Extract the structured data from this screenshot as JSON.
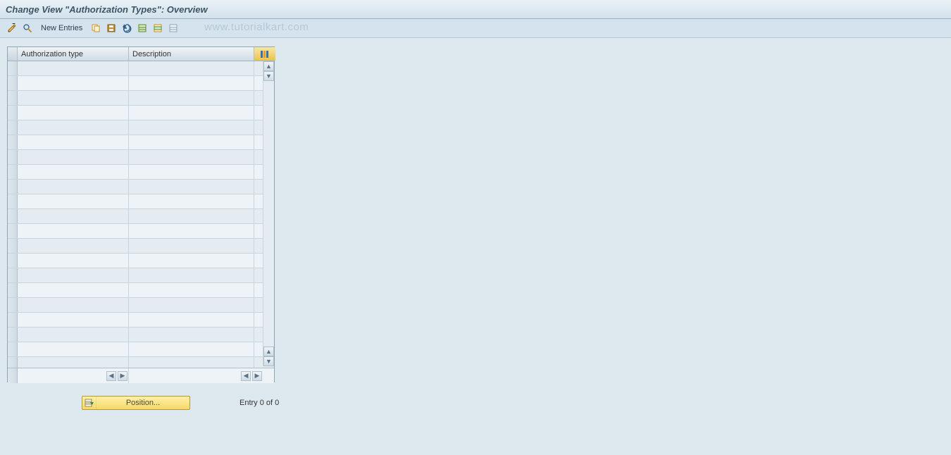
{
  "header": {
    "title": "Change View \"Authorization Types\": Overview"
  },
  "toolbar": {
    "new_entries_label": "New Entries"
  },
  "watermark": "www.tutorialkart.com",
  "table": {
    "columns": {
      "col1": "Authorization type",
      "col2": "Description"
    },
    "rows": []
  },
  "footer": {
    "position_label": "Position...",
    "entry_text": "Entry 0 of 0"
  },
  "icons": {
    "toggle": "toggle-display-change-icon",
    "find": "find-icon",
    "copy": "copy-icon",
    "save": "save-icon",
    "undo": "undo-icon",
    "select_all": "select-all-icon",
    "select_block": "select-block-icon",
    "deselect": "deselect-all-icon",
    "table_settings": "table-settings-icon"
  }
}
